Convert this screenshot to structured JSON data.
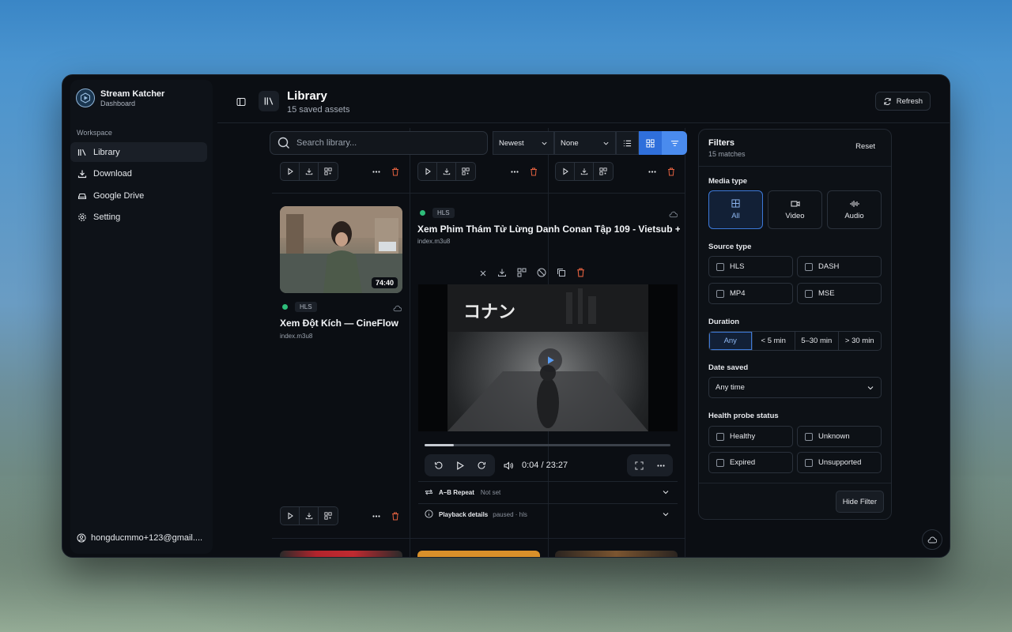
{
  "app": {
    "name": "Stream Katcher",
    "subtitle": "Dashboard"
  },
  "sidebar": {
    "section": "Workspace",
    "items": [
      {
        "label": "Library",
        "icon": "library-icon",
        "active": true
      },
      {
        "label": "Download",
        "icon": "download-icon"
      },
      {
        "label": "Google Drive",
        "icon": "drive-icon"
      },
      {
        "label": "Setting",
        "icon": "gear-icon"
      }
    ],
    "user": "hongducmmo+123@gmail...."
  },
  "header": {
    "title": "Library",
    "subtitle": "15 saved assets",
    "refresh": "Refresh"
  },
  "toolbar": {
    "search_placeholder": "Search library...",
    "sort": "Newest",
    "group": "None"
  },
  "cards": [
    {
      "badge": "HLS",
      "title": "Xem Đột Kích — CineFlow",
      "file": "index.m3u8",
      "duration": "74:40"
    },
    {
      "badge": "HLS",
      "title": "Xem Phim Thám Tử Lừng Danh Conan Tập 109 - Vietsub + ...",
      "file": "index.m3u8"
    }
  ],
  "player": {
    "time": "0:04 / 23:27",
    "progress": 0.12,
    "ab_label": "A–B Repeat",
    "ab_value": "Not set",
    "details_label": "Playback details",
    "details_value": "paused · hls"
  },
  "filters": {
    "title": "Filters",
    "matches": "15 matches",
    "reset": "Reset",
    "media_type_label": "Media type",
    "media_types": [
      "All",
      "Video",
      "Audio"
    ],
    "source_type_label": "Source type",
    "source_types": [
      "HLS",
      "DASH",
      "MP4",
      "MSE"
    ],
    "duration_label": "Duration",
    "durations": [
      "Any",
      "< 5 min",
      "5–30 min",
      "> 30 min"
    ],
    "date_label": "Date saved",
    "date_value": "Any time",
    "health_label": "Health probe status",
    "health": [
      "Healthy",
      "Unknown",
      "Expired",
      "Unsupported"
    ],
    "hide": "Hide Filter"
  },
  "colors": {
    "accent": "#2f6fdb",
    "healthy": "#2ebd7a",
    "danger": "#e2603f"
  }
}
